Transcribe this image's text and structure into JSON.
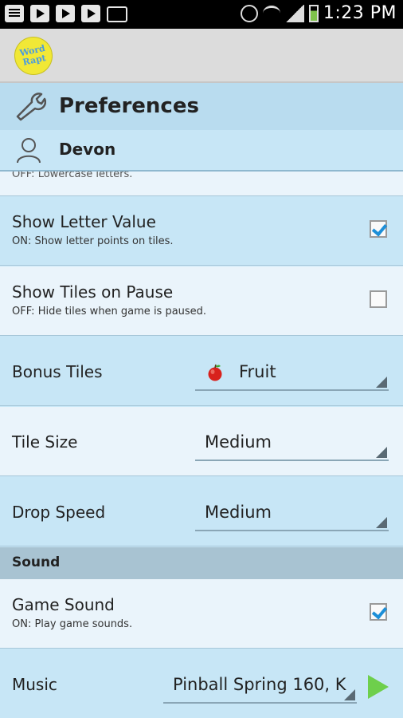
{
  "status_bar": {
    "time": "1:23 PM",
    "icons": [
      "clipboard-icon",
      "play-store-icon",
      "play-store-icon",
      "play-store-icon",
      "voicemail-icon",
      "gps-icon",
      "wifi-icon",
      "signal-icon",
      "battery-icon"
    ]
  },
  "app": {
    "logo_line1": "Word",
    "logo_line2": "Rapt"
  },
  "header": {
    "title": "Preferences",
    "icon": "wrench-icon"
  },
  "user": {
    "name": "Devon",
    "icon": "user-icon"
  },
  "cutoff_row": {
    "subtitle": "OFF: Lowercase letters."
  },
  "rows": {
    "show_letter_value": {
      "title": "Show Letter Value",
      "subtitle": "ON:  Show letter points on tiles.",
      "checked": true
    },
    "show_tiles_on_pause": {
      "title": "Show Tiles on Pause",
      "subtitle": "OFF: Hide tiles when game is paused.",
      "checked": false
    },
    "bonus_tiles": {
      "title": "Bonus Tiles",
      "value": "Fruit",
      "icon": "apple-icon"
    },
    "tile_size": {
      "title": "Tile Size",
      "value": "Medium"
    },
    "drop_speed": {
      "title": "Drop Speed",
      "value": "Medium"
    },
    "game_sound": {
      "title": "Game Sound",
      "subtitle": "ON:  Play game sounds.",
      "checked": true
    },
    "music": {
      "title": "Music",
      "value": "Pinball Spring 160, K"
    }
  },
  "section_sound": {
    "label": "Sound"
  },
  "colors": {
    "row_blue": "#c7e6f6",
    "row_light": "#eaf4fb",
    "accent": "#1d8fd8",
    "play_green": "#6ecf4c"
  }
}
